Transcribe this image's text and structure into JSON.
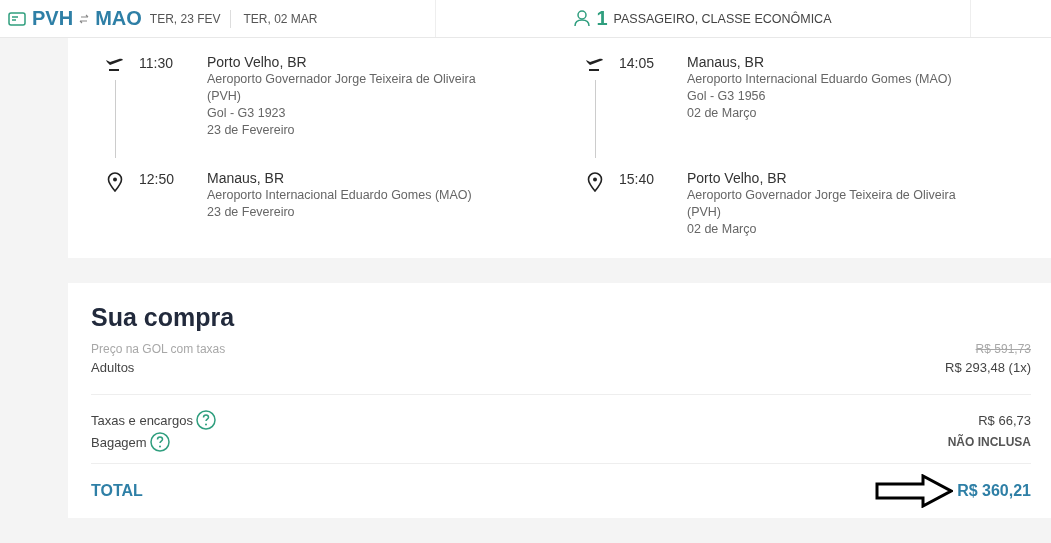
{
  "header": {
    "origin": "PVH",
    "destination": "MAO",
    "outbound_date": "TER, 23 FEV",
    "return_date": "TER, 02 MAR",
    "passenger_count": "1",
    "passenger_text": "PASSAGEIRO, CLASSE ECONÔMICA"
  },
  "legs": [
    {
      "stops": [
        {
          "kind": "departure",
          "time": "11:30",
          "city": "Porto Velho, BR",
          "details": [
            "Aeroporto Governador Jorge Teixeira de Oliveira (PVH)",
            "Gol - G3 1923",
            "23 de Fevereiro"
          ]
        },
        {
          "kind": "arrival",
          "time": "12:50",
          "city": "Manaus, BR",
          "details": [
            "Aeroporto Internacional Eduardo Gomes (MAO)",
            "23 de Fevereiro"
          ]
        }
      ]
    },
    {
      "stops": [
        {
          "kind": "departure",
          "time": "14:05",
          "city": "Manaus, BR",
          "details": [
            "Aeroporto Internacional Eduardo Gomes (MAO)",
            "Gol - G3 1956",
            "02 de Março"
          ]
        },
        {
          "kind": "arrival",
          "time": "15:40",
          "city": "Porto Velho, BR",
          "details": [
            "Aeroporto Governador Jorge Teixeira de Oliveira (PVH)",
            "02 de Março"
          ]
        }
      ]
    }
  ],
  "purchase": {
    "title": "Sua compra",
    "original_price": {
      "label": "Preço na GOL com taxas",
      "value": "R$ 591,73"
    },
    "groups": [
      {
        "rows": [
          {
            "label": "Adultos",
            "value": "R$ 293,48 (1x)",
            "help": false,
            "emphasis": false
          }
        ]
      },
      {
        "rows": [
          {
            "label": "Taxas e encargos",
            "value": "R$ 66,73",
            "help": true,
            "emphasis": false
          },
          {
            "label": "Bagagem",
            "value": "NÃO INCLUSA",
            "help": true,
            "emphasis": true
          }
        ]
      }
    ],
    "total": {
      "label": "TOTAL",
      "value": "R$ 360,21"
    }
  }
}
